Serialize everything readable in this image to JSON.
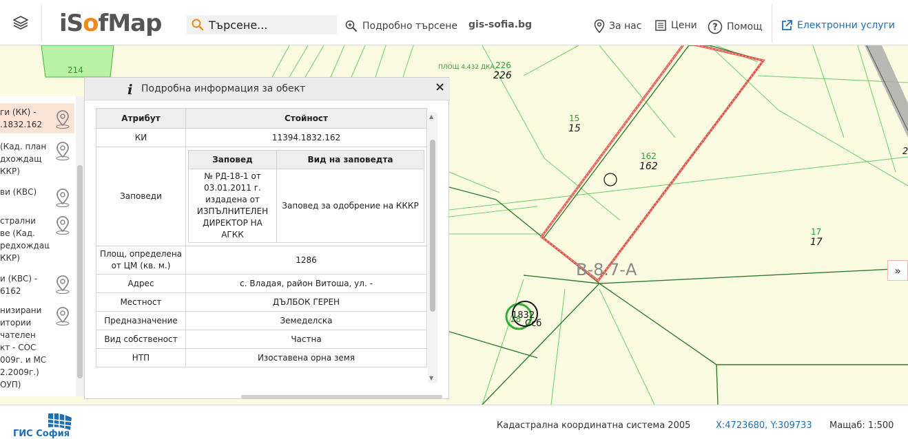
{
  "header": {
    "logo": {
      "i": "i",
      "s": "S",
      "o": "o",
      "f": "f",
      "map": "Map"
    },
    "search_placeholder": "Търсене...",
    "advanced_search": "Подробно търсене",
    "gis_link": "gis-sofia.bg",
    "about": "За нас",
    "prices": "Цени",
    "help": "Помощ",
    "eservices": "Електронни услуги"
  },
  "map": {
    "labels": [
      {
        "text": "214"
      },
      {
        "text": "ПЛОЩ 4.432 ДКА."
      },
      {
        "text": "226"
      },
      {
        "text": "226"
      },
      {
        "text": "15"
      },
      {
        "text": "15"
      },
      {
        "text": "162"
      },
      {
        "text": "162"
      },
      {
        "text": "17"
      },
      {
        "text": "17"
      },
      {
        "text": "В-8.7-А"
      },
      {
        "text": "1832"
      },
      {
        "text": "28"
      },
      {
        "text": "Ссб"
      },
      {
        "text": "2"
      }
    ],
    "expand_label": "»",
    "colors": {
      "background": "#fafbe1",
      "parcel_line": "#2e8b2e",
      "light_line": "#74d174",
      "highlight": "#e04848"
    }
  },
  "left_panel": {
    "items": [
      {
        "text": "ги (КК) -\n.1832.162",
        "active": true
      },
      {
        "text": "(Кад. план\nдхождащ\nККР)",
        "active": false
      },
      {
        "text": "ви (КВС)",
        "active": false
      },
      {
        "text": "стрални\nве (Кад.\nредхождащ\nККР)",
        "active": false
      },
      {
        "text": "и (КВС) -\n6162",
        "active": false
      },
      {
        "text": "низирани\nитории\nчателен\nкт - СОС\n009г. и МС\n2.2009г.)\nОУП)",
        "active": false
      }
    ]
  },
  "panel": {
    "title": "Подробна информация за обект",
    "close": "×",
    "columns": {
      "attribute": "Атрибут",
      "value": "Стойност"
    },
    "rows": {
      "ki_label": "КИ",
      "ki_value": "11394.1832.162",
      "orders_label": "Заповеди",
      "orders_sub": {
        "col1": "Заповед",
        "col2": "Вид на заповедта",
        "order": "№ РД-18-1 от 03.01.2011 г. издадена от ИЗПЪЛНИТЕЛЕН ДИРЕКТОР НА АГКК",
        "type": "Заповед за одобрение на КККР"
      },
      "area_label": "Площ, определена от ЦМ (кв. м.)",
      "area_value": "1286",
      "address_label": "Адрес",
      "address_value": "с. Владая, район Витоша, ул. -",
      "locality_label": "Местност",
      "locality_value": "ДЪЛБОК ГЕРЕН",
      "purpose_label": "Предназначение",
      "purpose_value": "Земеделска",
      "ownership_label": "Вид собственост",
      "ownership_value": "Частна",
      "ntp_label": "НТП",
      "ntp_value": "Изоставена орна земя"
    }
  },
  "footer": {
    "gis_logo_text": "ГИС София",
    "coord_system": "Кадастрална координатна система 2005",
    "coords": "X:4723680, Y:309733",
    "scale": "Мащаб: 1:500"
  }
}
